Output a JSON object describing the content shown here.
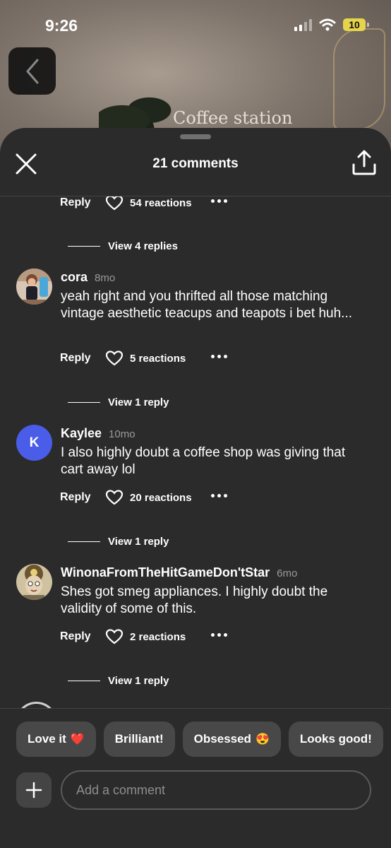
{
  "status": {
    "time": "9:26",
    "battery": "10"
  },
  "photo": {
    "caption": "Coffee station"
  },
  "sheet": {
    "title": "21 comments"
  },
  "comments_list": {
    "top_partial": {
      "reply_label": "Reply",
      "reactions": "54 reactions",
      "view_replies": "View 4 replies"
    },
    "items": [
      {
        "name": "cora",
        "time": "8mo",
        "text": "yeah right and you thrifted all those matching vintage aesthetic teacups and teapots i bet huh...",
        "reply_label": "Reply",
        "reactions": "5 reactions",
        "view_replies": "View 1 reply"
      },
      {
        "name": "Kaylee",
        "time": "10mo",
        "avatar_letter": "K",
        "text": "I also highly doubt a coffee shop was giving that cart away lol",
        "reply_label": "Reply",
        "reactions": "20 reactions",
        "view_replies": "View 1 reply"
      },
      {
        "name": "WinonaFromTheHitGameDon'tStar",
        "time": "6mo",
        "text": "Shes got smeg appliances. I highly doubt the validity of some of this.",
        "reply_label": "Reply",
        "reactions": "2 reactions",
        "view_replies": "View 1 reply"
      }
    ]
  },
  "quick_replies": [
    {
      "label": "Love it",
      "emoji": "❤️"
    },
    {
      "label": "Brilliant!"
    },
    {
      "label": "Obsessed",
      "emoji": "😍"
    },
    {
      "label": "Looks good!"
    }
  ],
  "composer": {
    "placeholder": "Add a comment"
  },
  "colors": {
    "sheet_bg": "#2b2b2b",
    "chip_bg": "#484848",
    "avatar_k": "#4a5de8"
  },
  "icons": [
    "back-chevron-icon",
    "close-icon",
    "share-icon",
    "heart-icon",
    "more-icon",
    "plus-icon",
    "wifi-icon",
    "signal-icon",
    "battery-icon"
  ]
}
